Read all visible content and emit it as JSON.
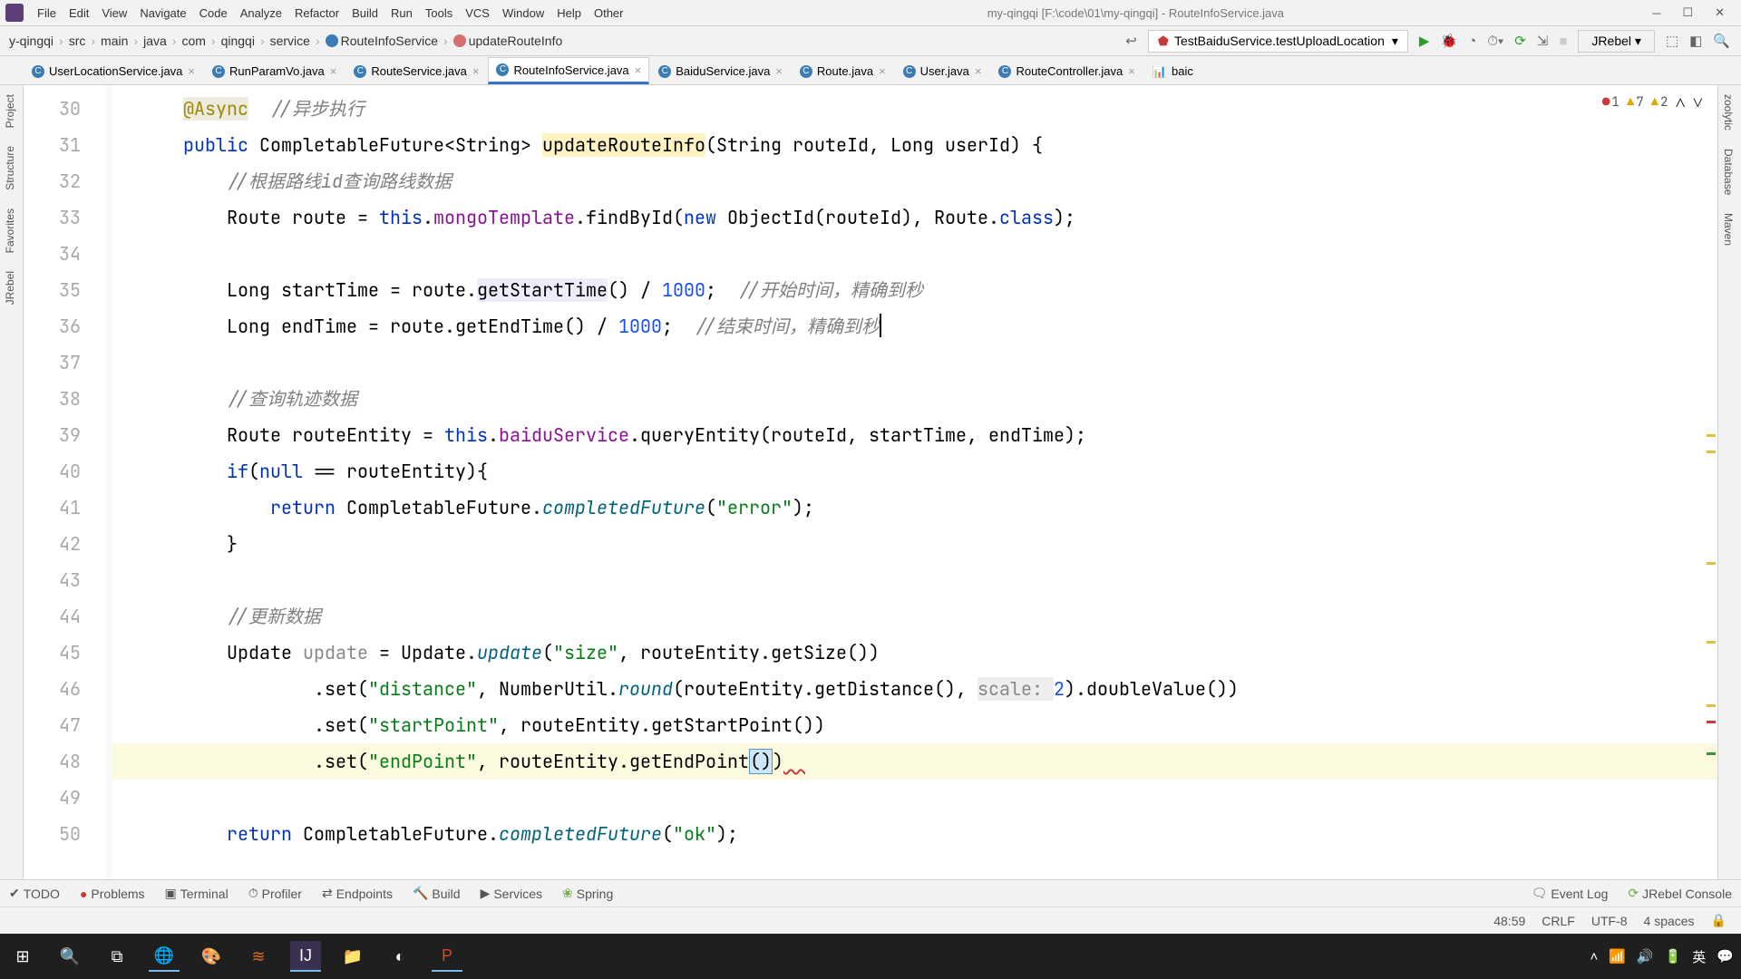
{
  "window": {
    "title": "my-qingqi [F:\\code\\01\\my-qingqi] - RouteInfoService.java"
  },
  "menu": [
    "File",
    "Edit",
    "View",
    "Navigate",
    "Code",
    "Analyze",
    "Refactor",
    "Build",
    "Run",
    "Tools",
    "VCS",
    "Window",
    "Help",
    "Other"
  ],
  "breadcrumbs": [
    "y-qingqi",
    "src",
    "main",
    "java",
    "com",
    "qingqi",
    "service"
  ],
  "bc_class": "RouteInfoService",
  "bc_method": "updateRouteInfo",
  "run_config": "TestBaiduService.testUploadLocation",
  "jrebel": "JRebel",
  "tabs": [
    {
      "label": "UserLocationService.java"
    },
    {
      "label": "RunParamVo.java"
    },
    {
      "label": "RouteService.java"
    },
    {
      "label": "RouteInfoService.java",
      "active": true
    },
    {
      "label": "BaiduService.java"
    },
    {
      "label": "Route.java"
    },
    {
      "label": "User.java"
    },
    {
      "label": "RouteController.java"
    },
    {
      "label": "baic",
      "icon": "chart"
    }
  ],
  "left_tools": [
    "Project",
    "Structure",
    "Favorites",
    "JRebel"
  ],
  "right_tools": [
    "zoolytic",
    "Database",
    "Maven"
  ],
  "inspections": {
    "errors": "1",
    "warnings": "7",
    "weak": "2"
  },
  "lines": {
    "from": 30,
    "to": 50
  },
  "code": {
    "l30_ann": "@Async",
    "l30_com": "//异步执行",
    "l31_kw": "public",
    "l31_ret": "CompletableFuture<String>",
    "l31_name": "updateRouteInfo",
    "l31_params": "(String routeId, Long userId) {",
    "l32": "//根据路线id查询路线数据",
    "l33_a": "Route route = ",
    "l33_this": "this",
    "l33_b": ".",
    "l33_mt": "mongoTemplate",
    "l33_c": ".findById(",
    "l33_new": "new",
    "l33_d": " ObjectId(routeId), Route.",
    "l33_cls": "class",
    "l33_e": ");",
    "l35_a": "Long startTime = route.",
    "l35_hl": "getStartTime",
    "l35_b": "() / ",
    "l35_n": "1000",
    "l35_c": ";  ",
    "l35_com": "//开始时间，精确到秒",
    "l36_a": "Long endTime = route.getEndTime() / ",
    "l36_n": "1000",
    "l36_b": ";  ",
    "l36_com": "//结束时间，精确到秒",
    "l38": "//查询轨迹数据",
    "l39_a": "Route routeEntity = ",
    "l39_this": "this",
    "l39_b": ".",
    "l39_bs": "baiduService",
    "l39_c": ".queryEntity(routeId, startTime, endTime);",
    "l40_a": "if",
    "l40_b": "(",
    "l40_null": "null",
    "l40_c": " == routeEntity){",
    "l41_ret": "return",
    "l41_a": " CompletableFuture.",
    "l41_cf": "completedFuture",
    "l41_b": "(",
    "l41_s": "\"error\"",
    "l41_c": ");",
    "l42": "}",
    "l44": "//更新数据",
    "l45_a": "Update ",
    "l45_u": "update",
    "l45_b": " = Update.",
    "l45_up": "update",
    "l45_c": "(",
    "l45_s": "\"size\"",
    "l45_d": ", routeEntity.getSize())",
    "l46_a": ".set(",
    "l46_s": "\"distance\"",
    "l46_b": ", NumberUtil.",
    "l46_r": "round",
    "l46_c": "(routeEntity.getDistance(), ",
    "l46_hint": "scale: ",
    "l46_n": "2",
    "l46_d": ").doubleValue())",
    "l47_a": ".set(",
    "l47_s": "\"startPoint\"",
    "l47_b": ", routeEntity.getStartPoint())",
    "l48_a": ".set(",
    "l48_s": "\"endPoint\"",
    "l48_b": ", routeEntity.getEndPoint",
    "l48_p": "()",
    "l48_c": ")",
    "l50_ret": "return",
    "l50_a": " CompletableFuture.",
    "l50_cf": "completedFuture",
    "l50_b": "(",
    "l50_s": "\"ok\"",
    "l50_c": ");"
  },
  "bottom": [
    "TODO",
    "Problems",
    "Terminal",
    "Profiler",
    "Endpoints",
    "Build",
    "Services",
    "Spring"
  ],
  "bottom_right": [
    "Event Log",
    "JRebel Console"
  ],
  "status": {
    "pos": "48:59",
    "eol": "CRLF",
    "enc": "UTF-8",
    "indent": "4 spaces"
  },
  "tray": {
    "ime": "英"
  }
}
